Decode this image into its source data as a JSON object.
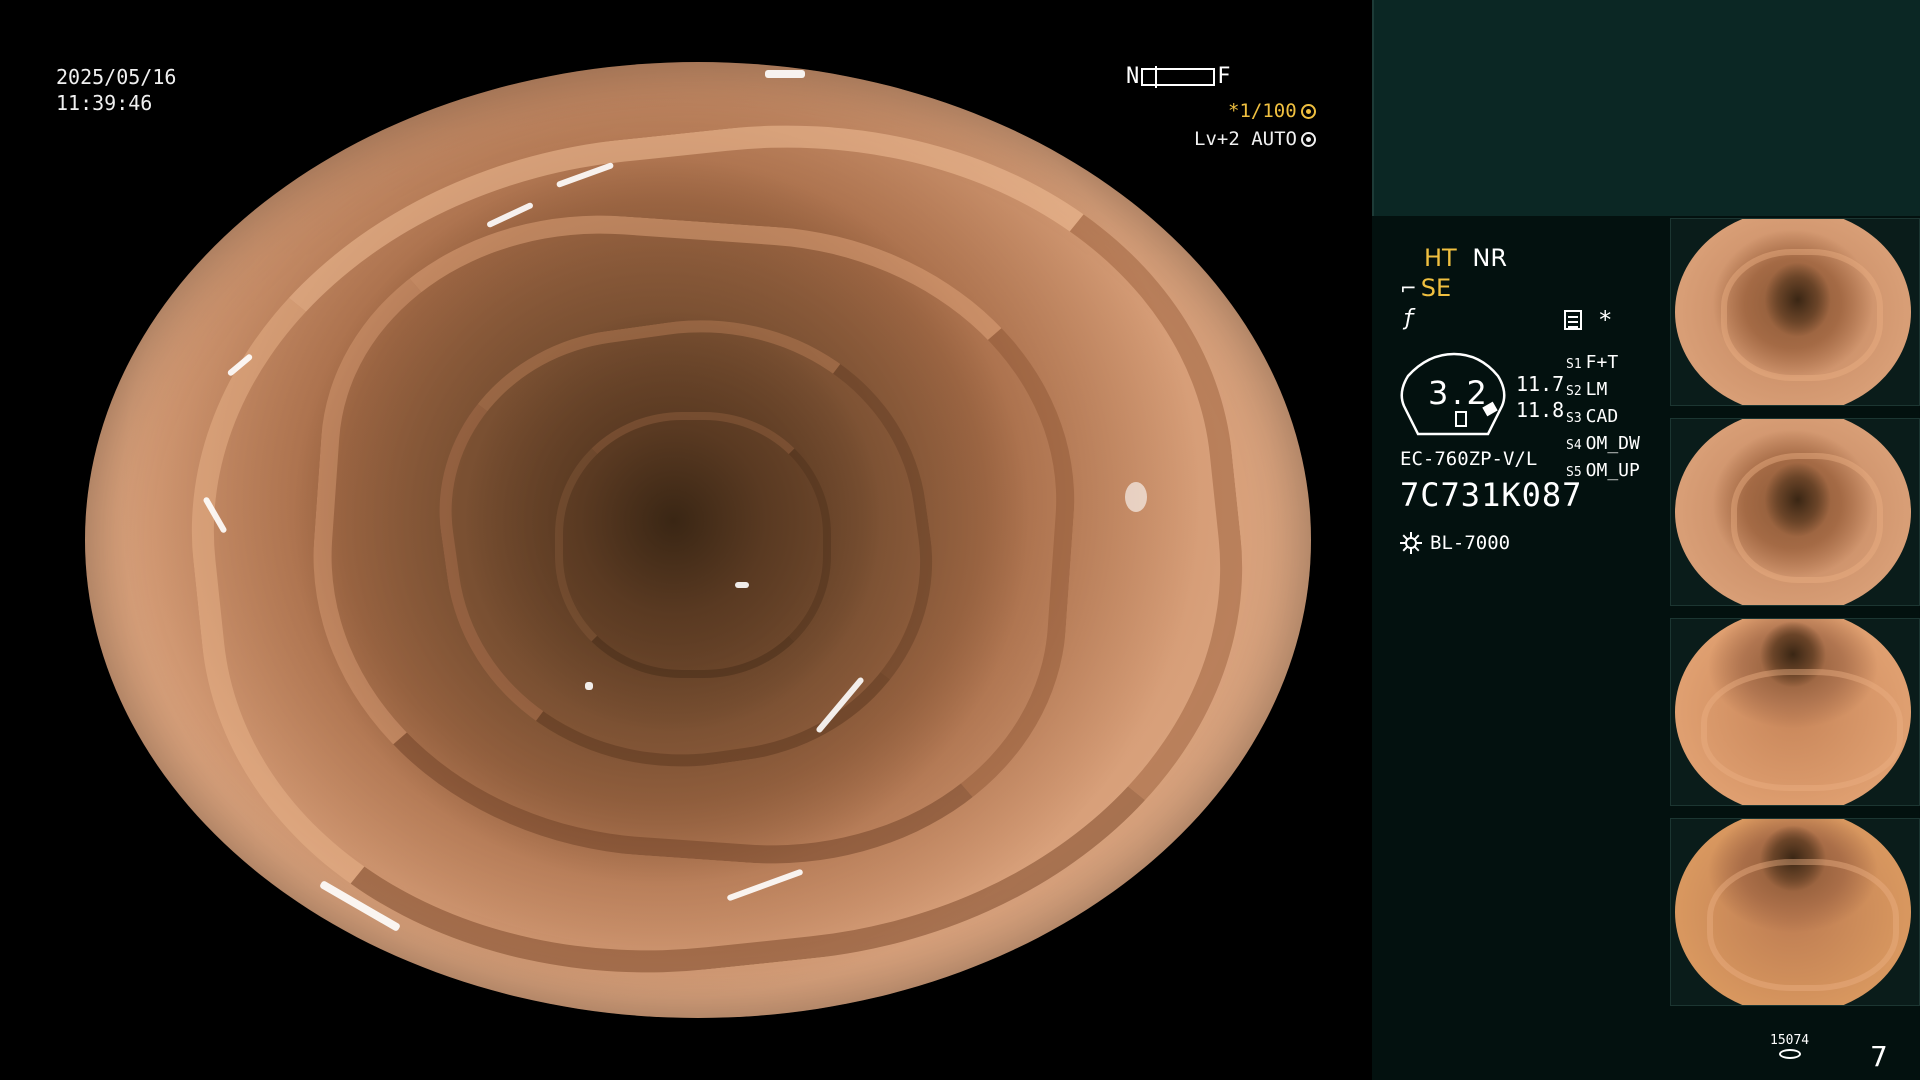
{
  "overlay": {
    "date": "2025/05/16",
    "time": "11:39:46",
    "focus_near": "N",
    "focus_far": "F",
    "shutter": "*1/100",
    "iris": "Lv+2 AUTO"
  },
  "panel": {
    "ht": "HT",
    "nr": "NR",
    "se": "SE",
    "star": "*",
    "gauge_value": "3.2",
    "gauge_val1": "11.7",
    "gauge_val2": "11.8",
    "scope_model": "EC-760ZP-V/L",
    "serial": "7C731K087",
    "light_source": "BL-7000",
    "settings": [
      {
        "key": "S1",
        "value": "F+T"
      },
      {
        "key": "S2",
        "value": "LM"
      },
      {
        "key": "S3",
        "value": "CAD"
      },
      {
        "key": "S4",
        "value": "OM_DW"
      },
      {
        "key": "S5",
        "value": "OM_UP"
      }
    ],
    "counter": "15074",
    "page": "7"
  },
  "icons": {
    "shutter_icon": "aperture-icon",
    "iris_icon": "iris-icon",
    "se_icon": "enhance-icon",
    "curve_icon": "tone-curve-icon",
    "memo_icon": "memo-icon",
    "light_icon": "light-source-icon",
    "counter_icon": "storage-icon"
  },
  "colors": {
    "accent_yellow": "#f0c040",
    "panel_bg": "#03110f",
    "panel_top": "#0b2724"
  }
}
